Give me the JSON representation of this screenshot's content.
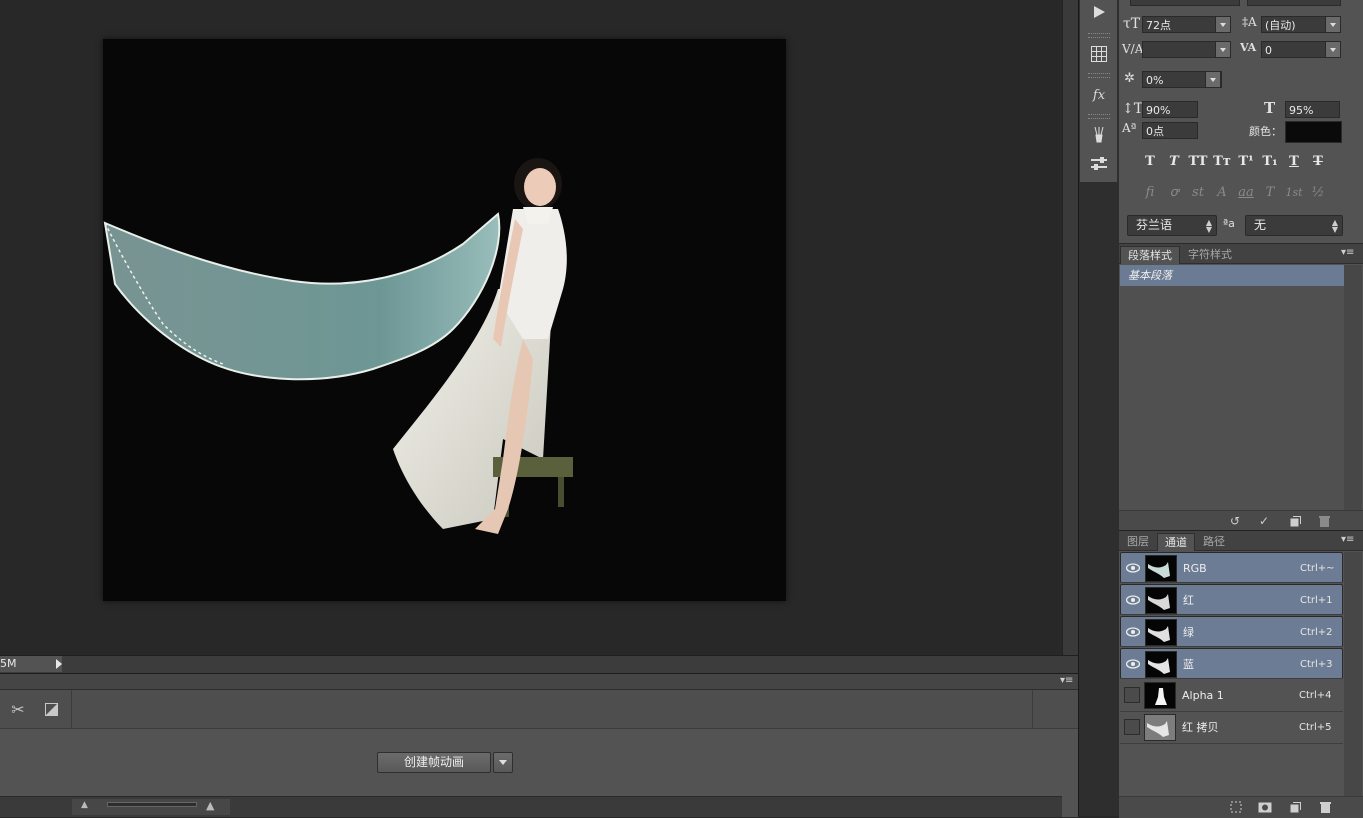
{
  "document": {
    "status_text": "5M"
  },
  "timeline": {
    "create_button_label": "创建帧动画"
  },
  "character": {
    "font_size": "72点",
    "leading": "(自动)",
    "kerning": "",
    "tracking": "0",
    "tsume": "0%",
    "vertical_scale": "90%",
    "horizontal_scale": "95%",
    "baseline_shift": "0点",
    "color_label": "颜色：",
    "color_value": "#0a0a0a",
    "type_buttons": [
      "T",
      "T",
      "TT",
      "Tт",
      "T¹",
      "T₁",
      "T",
      "T"
    ],
    "opentype_buttons": [
      "fi",
      "ꝍ",
      "st",
      "A",
      "aa",
      "T",
      "1st",
      "½"
    ],
    "language": "芬兰语",
    "aa_label": "ªa",
    "antialias": "无"
  },
  "paragraph_styles": {
    "tabs": [
      "段落样式",
      "字符样式"
    ],
    "items": [
      "基本段落"
    ]
  },
  "channels_panel": {
    "tabs": [
      "图层",
      "通道",
      "路径"
    ],
    "channels": [
      {
        "name": "RGB",
        "shortcut": "Ctrl+~",
        "visible": true,
        "selected": true
      },
      {
        "name": "红",
        "shortcut": "Ctrl+1",
        "visible": true,
        "selected": true
      },
      {
        "name": "绿",
        "shortcut": "Ctrl+2",
        "visible": true,
        "selected": true
      },
      {
        "name": "蓝",
        "shortcut": "Ctrl+3",
        "visible": true,
        "selected": true
      },
      {
        "name": "Alpha 1",
        "shortcut": "Ctrl+4",
        "visible": false,
        "selected": false
      },
      {
        "name": "红 拷贝",
        "shortcut": "Ctrl+5",
        "visible": false,
        "selected": false
      }
    ]
  },
  "colors": {
    "selection": "#6c7c94",
    "panel": "#535353",
    "canvas": "#070707"
  }
}
